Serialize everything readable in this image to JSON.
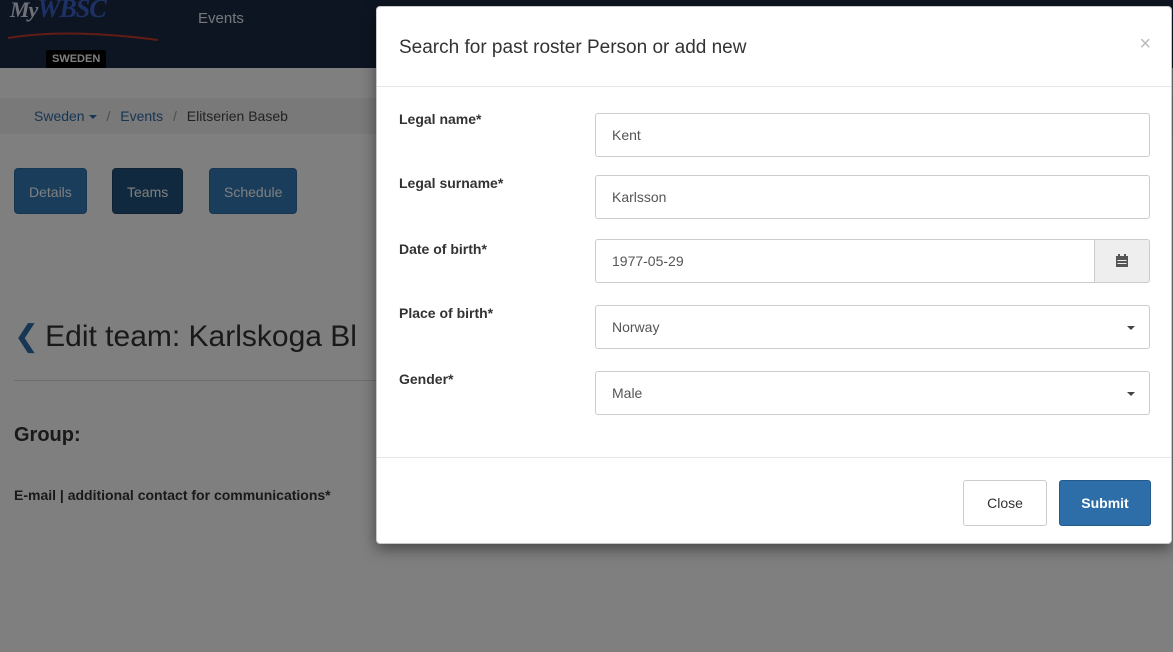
{
  "brand": {
    "logo_my": "My",
    "logo_word": "WBSC",
    "country": "SWEDEN"
  },
  "nav": {
    "events": "Events"
  },
  "breadcrumb": {
    "items": [
      "Sweden",
      "Events",
      "Elitserien Baseb"
    ]
  },
  "tabs": [
    "Details",
    "Teams",
    "Schedule"
  ],
  "page": {
    "title": "Edit team: Karlskoga Bl",
    "group_label": "Group:",
    "email_label": "E-mail | additional contact for communications*"
  },
  "modal": {
    "title": "Search for past roster Person or add new",
    "close_symbol": "×",
    "fields": [
      {
        "label": "Legal name*",
        "value": "Kent"
      },
      {
        "label": "Legal surname*",
        "value": "Karlsson"
      },
      {
        "label": "Date of birth*",
        "value": "1977-05-29",
        "icon": "calendar-icon"
      },
      {
        "label": "Place of birth*",
        "value": "Norway",
        "type": "select"
      },
      {
        "label": "Gender*",
        "value": "Male",
        "type": "select"
      }
    ],
    "close_button": "Close",
    "submit_button": "Submit"
  },
  "colors": {
    "topbar": "#1c2a44",
    "primary": "#337ab7",
    "submit": "#2d6ea8",
    "backdrop": "rgba(0,0,0,0.5)"
  }
}
